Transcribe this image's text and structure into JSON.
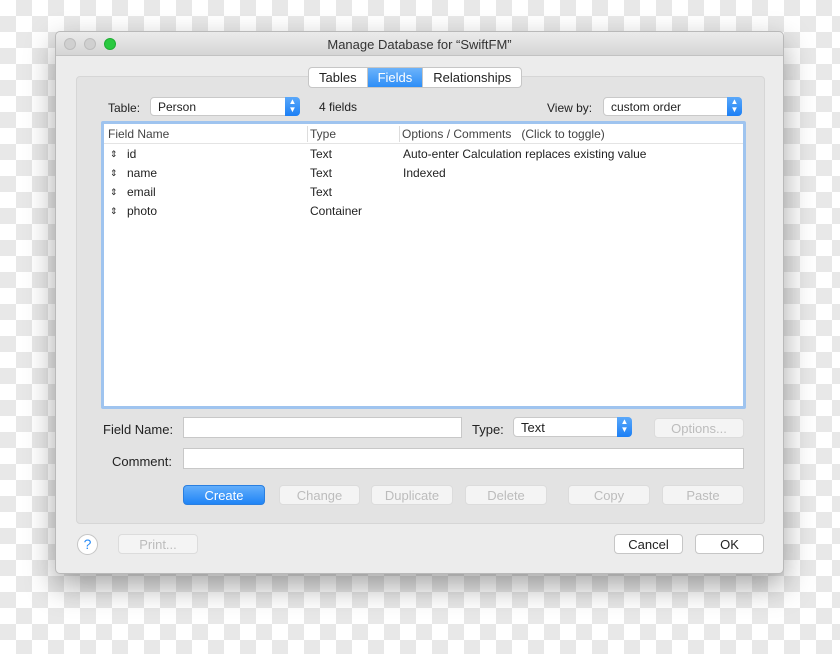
{
  "window": {
    "title": "Manage Database for “SwiftFM”"
  },
  "tabs": [
    {
      "label": "Tables",
      "selected": false
    },
    {
      "label": "Fields",
      "selected": true
    },
    {
      "label": "Relationships",
      "selected": false
    }
  ],
  "table_label": "Table:",
  "table_value": "Person",
  "field_count": "4 fields",
  "view_by_label": "View by:",
  "view_by_value": "custom order",
  "columns": [
    "Field Name",
    "Type",
    "Options / Comments   (Click to toggle)"
  ],
  "rows": [
    {
      "name": "id",
      "type": "Text",
      "options": "Auto-enter Calculation replaces existing value"
    },
    {
      "name": "name",
      "type": "Text",
      "options": "Indexed"
    },
    {
      "name": "email",
      "type": "Text",
      "options": ""
    },
    {
      "name": "photo",
      "type": "Container",
      "options": ""
    }
  ],
  "form": {
    "field_name_label": "Field Name:",
    "field_name_value": "",
    "type_label": "Type:",
    "type_value": "Text",
    "options_button": "Options...",
    "comment_label": "Comment:",
    "comment_value": ""
  },
  "actions": {
    "create": "Create",
    "change": "Change",
    "duplicate": "Duplicate",
    "delete": "Delete",
    "copy": "Copy",
    "paste": "Paste"
  },
  "footer": {
    "help": "?",
    "print": "Print...",
    "cancel": "Cancel",
    "ok": "OK"
  },
  "colors": {
    "accent": "#2a8cf7",
    "close": "#d0d0d0",
    "zoom": "#28c940"
  }
}
